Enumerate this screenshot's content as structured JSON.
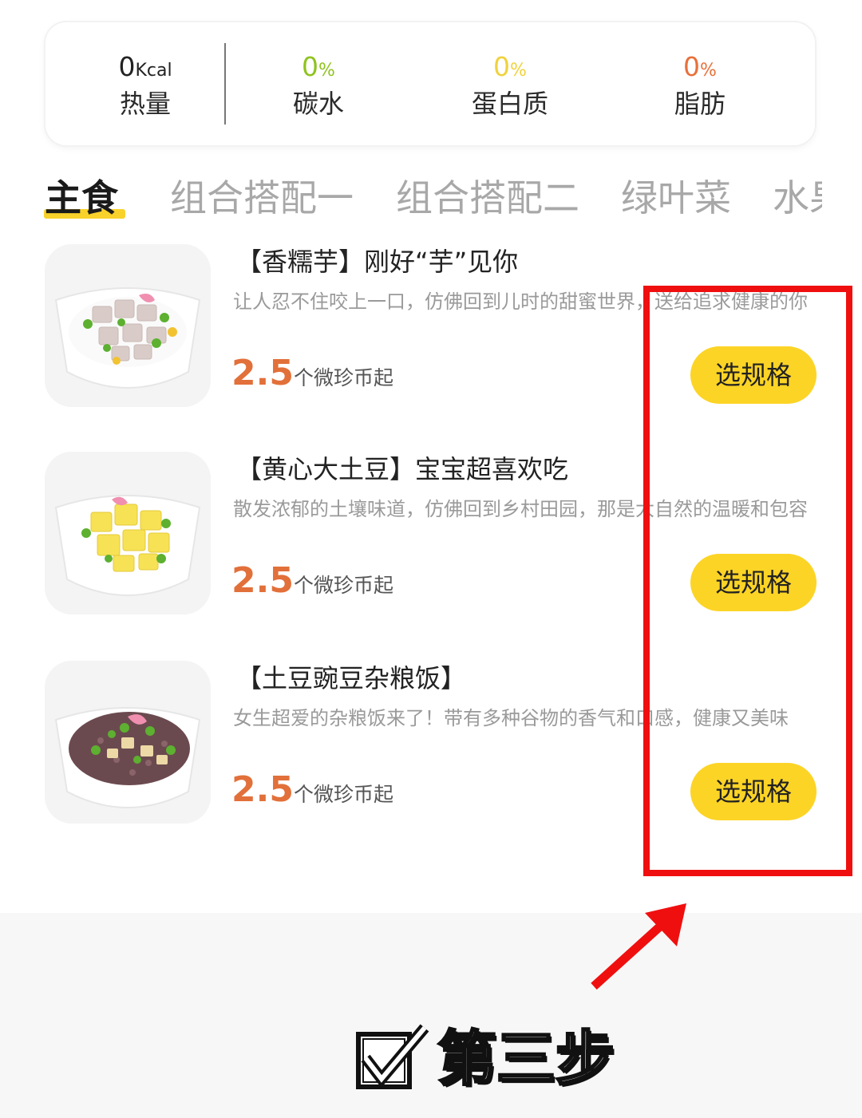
{
  "nutrition": {
    "calories": {
      "value": "0",
      "unit": "Kcal",
      "label": "热量"
    },
    "carbs": {
      "value": "0",
      "unit": "%",
      "label": "碳水",
      "color": "#8fc31f"
    },
    "protein": {
      "value": "0",
      "unit": "%",
      "label": "蛋白质",
      "color": "#f0d23c"
    },
    "fat": {
      "value": "0",
      "unit": "%",
      "label": "脂肪",
      "color": "#e8703a"
    }
  },
  "tabs": [
    {
      "label": "主食",
      "active": true
    },
    {
      "label": "组合搭配一",
      "active": false
    },
    {
      "label": "组合搭配二",
      "active": false
    },
    {
      "label": "绿叶菜",
      "active": false
    },
    {
      "label": "水果",
      "active": false
    }
  ],
  "products": [
    {
      "title": "【香糯芋】刚好“芋”见你",
      "description": "让人忍不住咬上一口，仿佛回到儿时的甜蜜世界，送给追求健康的你",
      "price": "2.5",
      "price_unit": "个微珍币起",
      "button": "选规格"
    },
    {
      "title": "【黄心大土豆】宝宝超喜欢吃",
      "description": "散发浓郁的土壤味道，仿佛回到乡村田园，那是大自然的温暖和包容",
      "price": "2.5",
      "price_unit": "个微珍币起",
      "button": "选规格"
    },
    {
      "title": "【土豆豌豆杂粮饭】",
      "description": "女生超爱的杂粮饭来了！带有多种谷物的香气和口感，健康又美味",
      "price": "2.5",
      "price_unit": "个微珍币起",
      "button": "选规格"
    }
  ],
  "annotation": {
    "step_text": "第三步",
    "highlight_color": "#f00f0f",
    "icon": "checkbox-icon"
  },
  "accent_color": "#fcd426",
  "price_color": "#e2703a"
}
